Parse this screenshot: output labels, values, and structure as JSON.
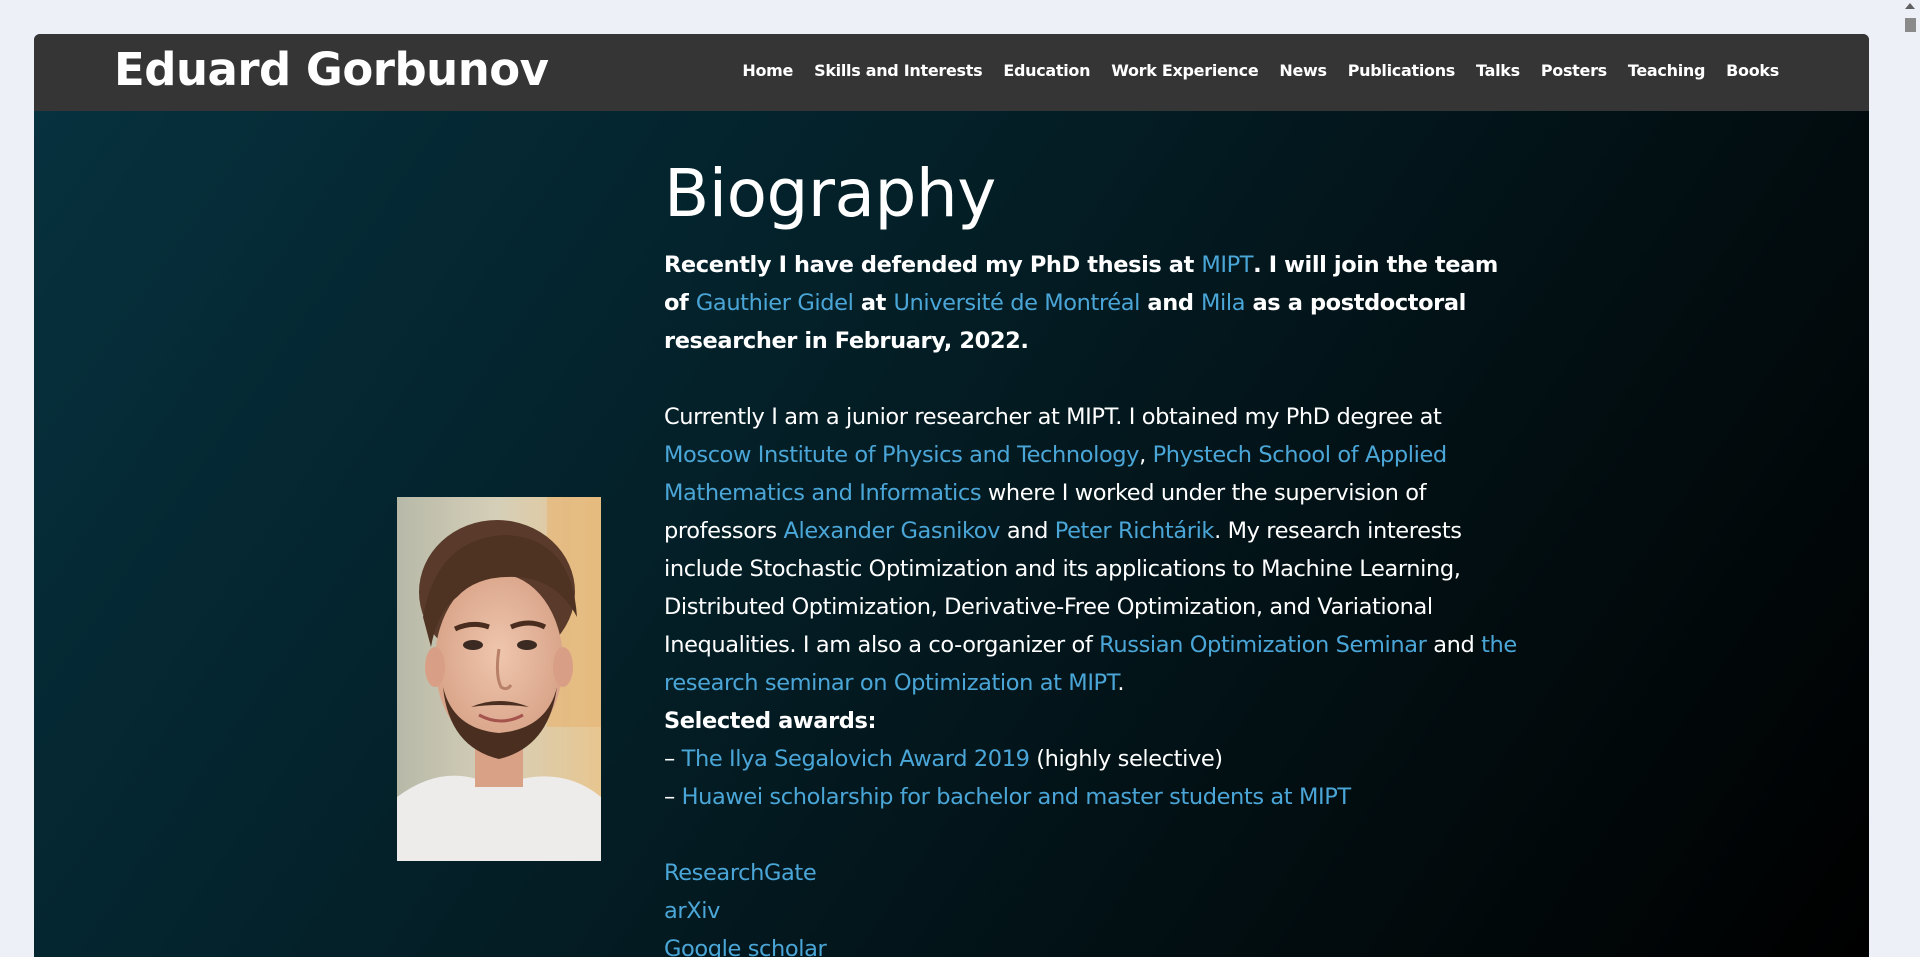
{
  "header": {
    "site_title": "Eduard Gorbunov",
    "nav": [
      "Home",
      "Skills and Interests",
      "Education",
      "Work Experience",
      "News",
      "Publications",
      "Talks",
      "Posters",
      "Teaching",
      "Books"
    ]
  },
  "bio": {
    "heading": "Biography",
    "intro": {
      "t1": "Recently I have defended my PhD thesis at ",
      "l1": "MIPT",
      "t2": ". I will join the team of ",
      "l2": "Gauthier Gidel",
      "t3": " at ",
      "l3": "Université de Montréal",
      "t4": " and ",
      "l4": "Mila",
      "t5": " as a postdoctoral researcher in February, 2022."
    },
    "para": {
      "t1": "Currently I am a junior researcher at MIPT. I obtained my PhD degree at ",
      "l1": "Moscow Institute of Physics and Technology",
      "t2": ", ",
      "l2": "Phystech School of Applied Mathematics and Informatics",
      "t3": " where I worked under the supervision of professors ",
      "l3": "Alexander Gasnikov",
      "t4": " and ",
      "l4": "Peter Richtárik",
      "t5": ". My research interests include Stochastic Optimization and its applications to Machine Learning, Distributed Optimization, Derivative-Free Optimization, and Variational Inequalities. I am also a co-organizer of ",
      "l5": "Russian Optimization Seminar",
      "t6": " and ",
      "l6": "the research seminar on Optimization at MIPT",
      "t7": "."
    },
    "awards_heading": "Selected awards:",
    "awards": [
      {
        "prefix": "– ",
        "link": "The Ilya Segalovich Award 2019",
        "suffix": " (highly selective)"
      },
      {
        "prefix": "– ",
        "link": "Huawei scholarship for bachelor and master students at MIPT",
        "suffix": ""
      }
    ],
    "profile_links": [
      "ResearchGate",
      "arXiv",
      "Google scholar"
    ]
  },
  "colors": {
    "link": "#4ba6d8",
    "navbar": "#353535",
    "page_bg": "#eef0f8"
  }
}
